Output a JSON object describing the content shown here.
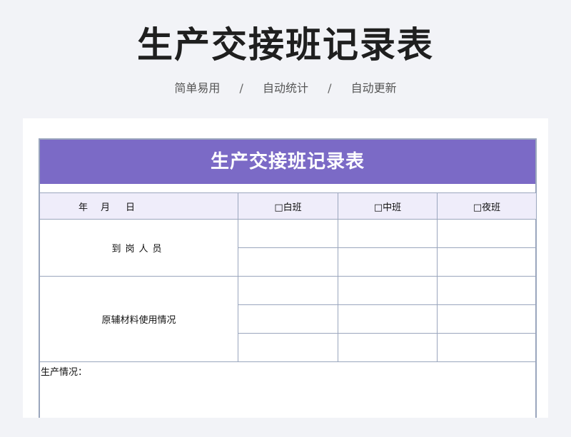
{
  "page": {
    "title": "生产交接班记录表",
    "subtitle_items": [
      "简单易用",
      "自动统计",
      "自动更新"
    ],
    "separator": "/"
  },
  "sheet": {
    "title": "生产交接班记录表",
    "date_label": {
      "year": "年",
      "month": "月",
      "day": "日"
    },
    "shift_columns": [
      "□白班",
      "□中班",
      "□夜班"
    ],
    "row_labels": {
      "staff": "到岗人员",
      "materials": "原辅材料使用情况",
      "production": "生产情况："
    }
  },
  "colors": {
    "header_bg": "#7b6ac6",
    "subheader_bg": "#efedfa",
    "border": "#9aa6bd",
    "page_bg": "#f2f3f7"
  }
}
